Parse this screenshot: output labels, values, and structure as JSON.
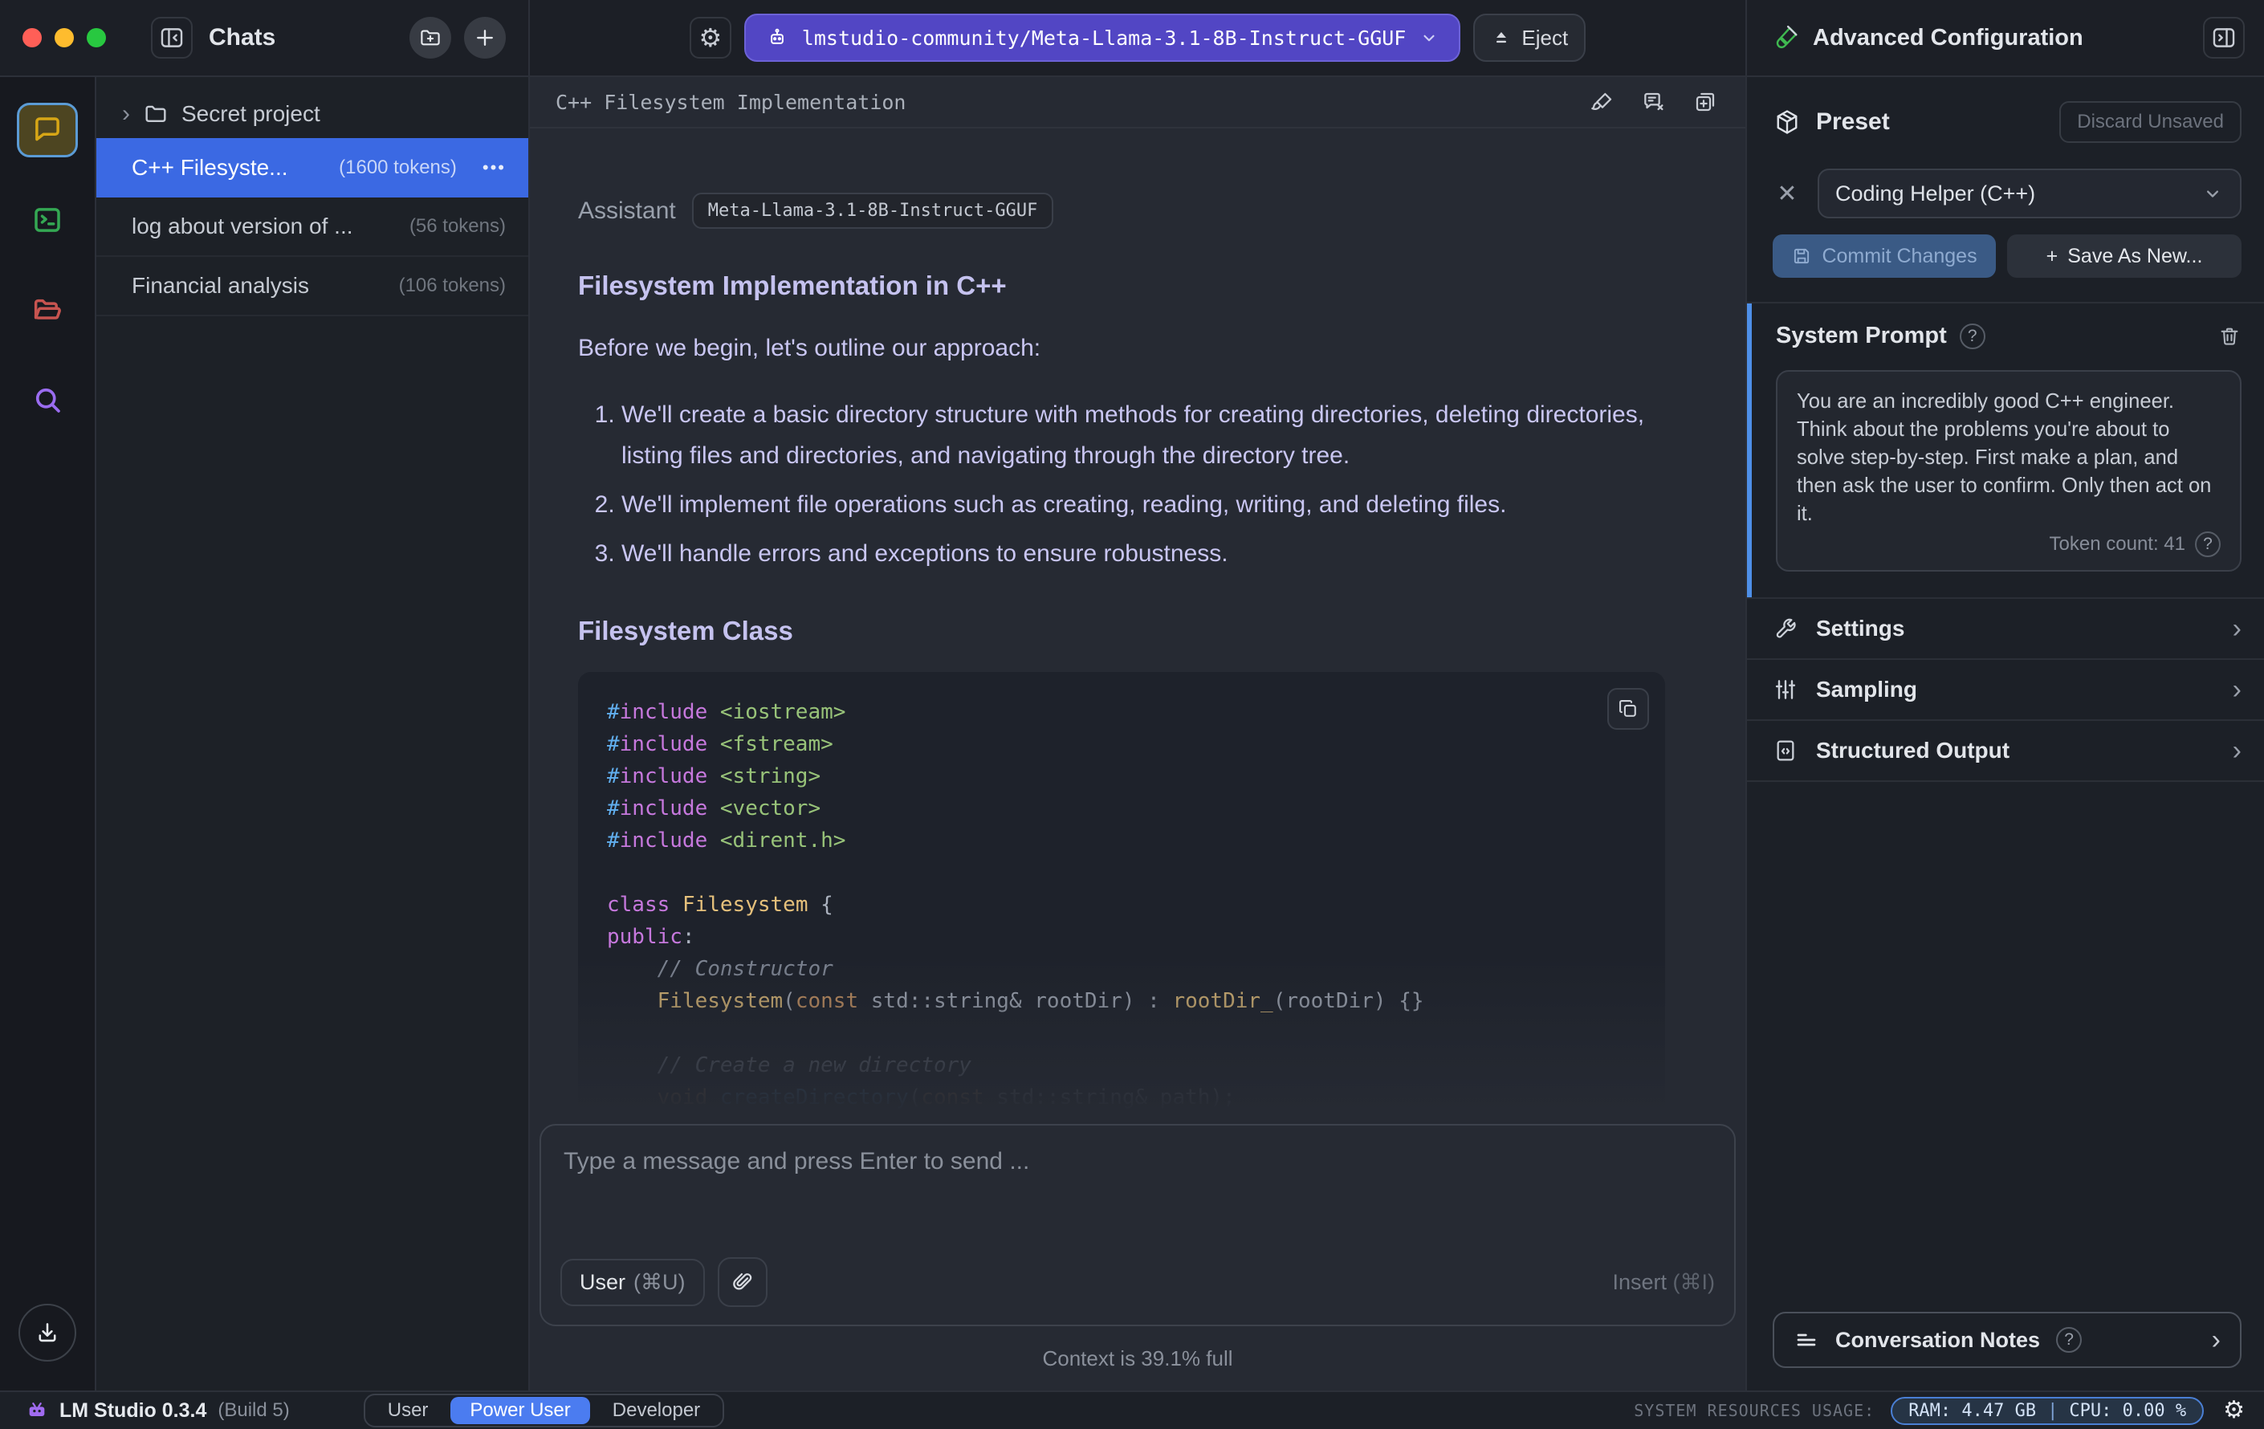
{
  "icons": {
    "help": "?",
    "dots": "•••",
    "chevron": "›",
    "close": "✕",
    "plus": "+",
    "gear": "⚙",
    "folder_chevron": "›"
  },
  "colors": {
    "accent_blue": "#3b69e3",
    "model_pill_bg": "#5246c4",
    "mode_active_bg": "#4b7cf0",
    "commit_bg": "#3a5a85",
    "commit_text": "#8fabd0",
    "prompt_accent": "#4e8fe8",
    "resources_border": "#4a7fd4",
    "rail_chat_yellow": "#d7a616",
    "rail_chat_selected_bg": "#4d4521",
    "rail_selected_border": "#5b9bd5",
    "rail_terminal_green": "#34a853",
    "rail_folder_red": "#c75450",
    "rail_search_purple": "#9a6cf0",
    "traffic_red": "#ff5f57",
    "traffic_yellow": "#febc2e",
    "traffic_green": "#28c840",
    "logo_purple": "#a06bf0",
    "code": {
      "h": "#61afef",
      "k": "#c678dd",
      "t": "#e5c07b",
      "s": "#98c379",
      "o": "#d19a66",
      "c": "#7f8694",
      "p": "#abb2bf",
      "b": "#61afef"
    }
  },
  "top_bar": {
    "model_label": "lmstudio-community/Meta-Llama-3.1-8B-Instruct-GGUF",
    "eject_label": "Eject"
  },
  "chats_panel": {
    "title": "Chats",
    "folder_name": "Secret project",
    "items": [
      {
        "title": "C++ Filesyste...",
        "tokens": "(1600 tokens)",
        "selected": true
      },
      {
        "title": "log about version of ...",
        "tokens": "(56 tokens)",
        "selected": false
      },
      {
        "title": "Financial analysis",
        "tokens": "(106 tokens)",
        "selected": false
      }
    ]
  },
  "chat": {
    "title": "C++ Filesystem Implementation",
    "assistant_label": "Assistant",
    "model_badge": "Meta-Llama-3.1-8B-Instruct-GGUF",
    "heading1": "Filesystem Implementation in C++",
    "intro": "Before we begin, let's outline our approach:",
    "list": [
      "We'll create a basic directory structure with methods for creating directories, deleting directories, listing files and directories, and navigating through the directory tree.",
      "We'll implement file operations such as creating, reading, writing, and deleting files.",
      "We'll handle errors and exceptions to ensure robustness."
    ],
    "heading2": "Filesystem Class",
    "code": {
      "lines": [
        {
          "d": 0,
          "s": [
            [
              "h",
              "#"
            ],
            [
              "k",
              "include"
            ],
            [
              "p",
              " "
            ],
            [
              "s",
              "<iostream>"
            ]
          ]
        },
        {
          "d": 0,
          "s": [
            [
              "h",
              "#"
            ],
            [
              "k",
              "include"
            ],
            [
              "p",
              " "
            ],
            [
              "s",
              "<fstream>"
            ]
          ]
        },
        {
          "d": 0,
          "s": [
            [
              "h",
              "#"
            ],
            [
              "k",
              "include"
            ],
            [
              "p",
              " "
            ],
            [
              "s",
              "<string>"
            ]
          ]
        },
        {
          "d": 0,
          "s": [
            [
              "h",
              "#"
            ],
            [
              "k",
              "include"
            ],
            [
              "p",
              " "
            ],
            [
              "s",
              "<vector>"
            ]
          ]
        },
        {
          "d": 0,
          "s": [
            [
              "h",
              "#"
            ],
            [
              "k",
              "include"
            ],
            [
              "p",
              " "
            ],
            [
              "s",
              "<dirent.h>"
            ]
          ]
        },
        {
          "d": 0,
          "s": []
        },
        {
          "d": 0,
          "s": [
            [
              "k",
              "class"
            ],
            [
              "p",
              " "
            ],
            [
              "t",
              "Filesystem"
            ],
            [
              "p",
              " {"
            ]
          ]
        },
        {
          "d": 0,
          "s": [
            [
              "k",
              "public"
            ],
            [
              "p",
              ":"
            ]
          ]
        },
        {
          "d": 0,
          "s": [
            [
              "c",
              "    // Constructor"
            ]
          ]
        },
        {
          "d": 0,
          "s": [
            [
              "p",
              "    "
            ],
            [
              "t",
              "Filesystem"
            ],
            [
              "p",
              "("
            ],
            [
              "o",
              "const"
            ],
            [
              "p",
              " std::string& rootDir) : "
            ],
            [
              "t",
              "rootDir_"
            ],
            [
              "p",
              "(rootDir) {}"
            ]
          ]
        },
        {
          "d": 0,
          "s": []
        },
        {
          "d": 1,
          "s": [
            [
              "c",
              "    // Create a new directory"
            ]
          ]
        },
        {
          "d": 2,
          "s": [
            [
              "p",
              "    "
            ],
            [
              "o",
              "void"
            ],
            [
              "p",
              " "
            ],
            [
              "b",
              "createDirectory"
            ],
            [
              "p",
              "("
            ],
            [
              "o",
              "const"
            ],
            [
              "p",
              " std::string& path);"
            ]
          ]
        }
      ]
    },
    "input_placeholder": "Type a message and press Enter to send ...",
    "user_button": "User",
    "user_shortcut": "(⌘U)",
    "insert_label": "Insert",
    "insert_shortcut": "(⌘I)",
    "context_status": "Context is 39.1% full"
  },
  "advanced_panel": {
    "title": "Advanced Configuration",
    "preset_label": "Preset",
    "discard_label": "Discard Unsaved",
    "preset_value": "Coding Helper (C++)",
    "commit_label": "Commit Changes",
    "save_as_new_label": "Save As New...",
    "system_prompt": {
      "label": "System Prompt",
      "text": "You are an incredibly good C++ engineer. Think about the problems you're about to solve step-by-step. First make a plan, and then ask the user to confirm. Only then act on it.",
      "token_count": "Token count: 41"
    },
    "sections": [
      {
        "label": "Settings"
      },
      {
        "label": "Sampling"
      },
      {
        "label": "Structured Output"
      }
    ],
    "notes_label": "Conversation Notes"
  },
  "status_bar": {
    "app": "LM Studio 0.3.4",
    "build": "(Build 5)",
    "modes": [
      "User",
      "Power User",
      "Developer"
    ],
    "resources_label": "SYSTEM RESOURCES USAGE:",
    "ram": "RAM: 4.47 GB",
    "sep": "|",
    "cpu": "CPU: 0.00 %"
  }
}
